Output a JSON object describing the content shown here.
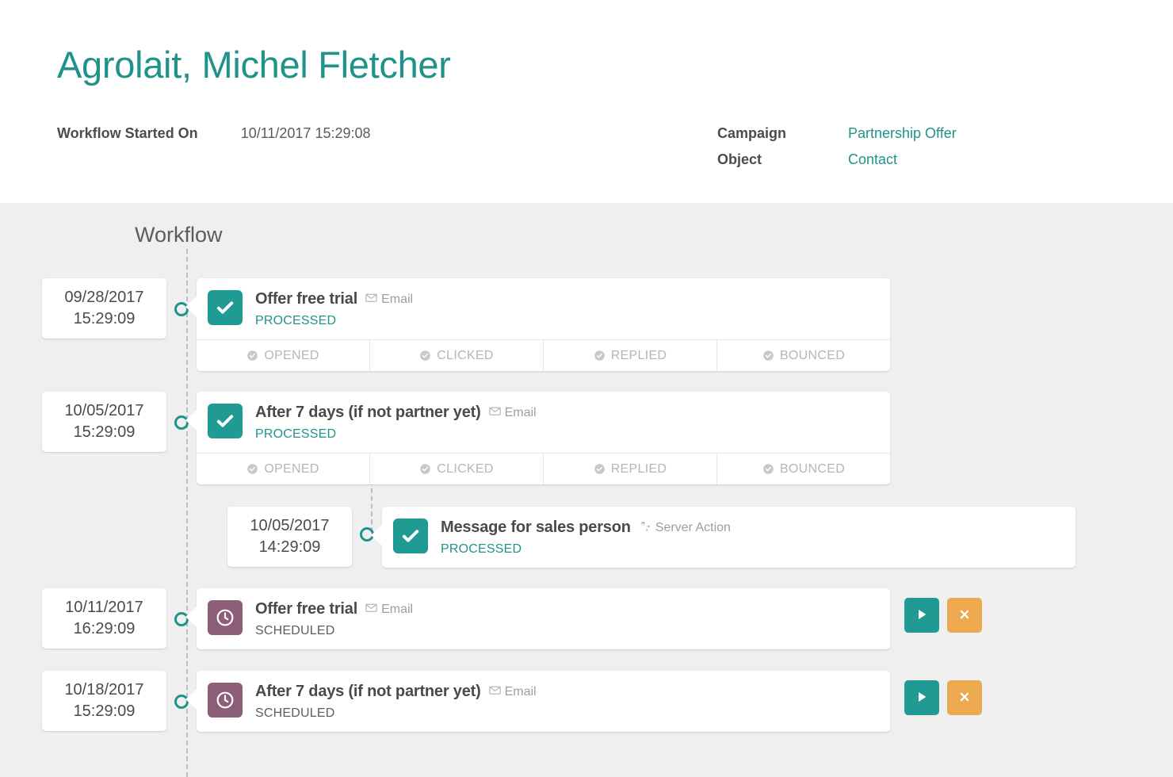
{
  "header": {
    "title": "Agrolait, Michel Fletcher",
    "started_label": "Workflow Started On",
    "started_value": "10/11/2017 15:29:08",
    "campaign_label": "Campaign",
    "campaign_value": "Partnership Offer",
    "object_label": "Object",
    "object_value": "Contact"
  },
  "workflow": {
    "heading": "Workflow",
    "metric_labels": [
      "OPENED",
      "CLICKED",
      "REPLIED",
      "BOUNCED"
    ],
    "steps": [
      {
        "date": "09/28/2017",
        "time": "15:29:09",
        "title": "Offer free trial",
        "type": "Email",
        "type_icon": "envelope-icon",
        "status": "PROCESSED",
        "state": "done",
        "state_icon": "check-icon",
        "has_metrics": true,
        "has_actions": false
      },
      {
        "date": "10/05/2017",
        "time": "15:29:09",
        "title": "After 7 days (if not partner yet)",
        "type": "Email",
        "type_icon": "envelope-icon",
        "status": "PROCESSED",
        "state": "done",
        "state_icon": "check-icon",
        "has_metrics": true,
        "has_actions": false
      },
      {
        "date": "10/05/2017",
        "time": "14:29:09",
        "title": "Message for sales person",
        "type": "Server Action",
        "type_icon": "cogs-icon",
        "status": "PROCESSED",
        "state": "done",
        "state_icon": "check-icon",
        "has_metrics": false,
        "has_actions": false
      },
      {
        "date": "10/11/2017",
        "time": "16:29:09",
        "title": "Offer free trial",
        "type": "Email",
        "type_icon": "envelope-icon",
        "status": "SCHEDULED",
        "state": "scheduled",
        "state_icon": "clock-icon",
        "has_metrics": false,
        "has_actions": true
      },
      {
        "date": "10/18/2017",
        "time": "15:29:09",
        "title": "After 7 days (if not partner yet)",
        "type": "Email",
        "type_icon": "envelope-icon",
        "status": "SCHEDULED",
        "state": "scheduled",
        "state_icon": "clock-icon",
        "has_metrics": false,
        "has_actions": true
      }
    ],
    "actions": {
      "run_label": "Run now",
      "cancel_label": "Cancel"
    }
  },
  "colors": {
    "teal": "#1f938a",
    "teal_icon": "#1f9b93",
    "purple": "#8d5e77",
    "orange": "#eda94f",
    "page_bg": "#efeff0"
  }
}
